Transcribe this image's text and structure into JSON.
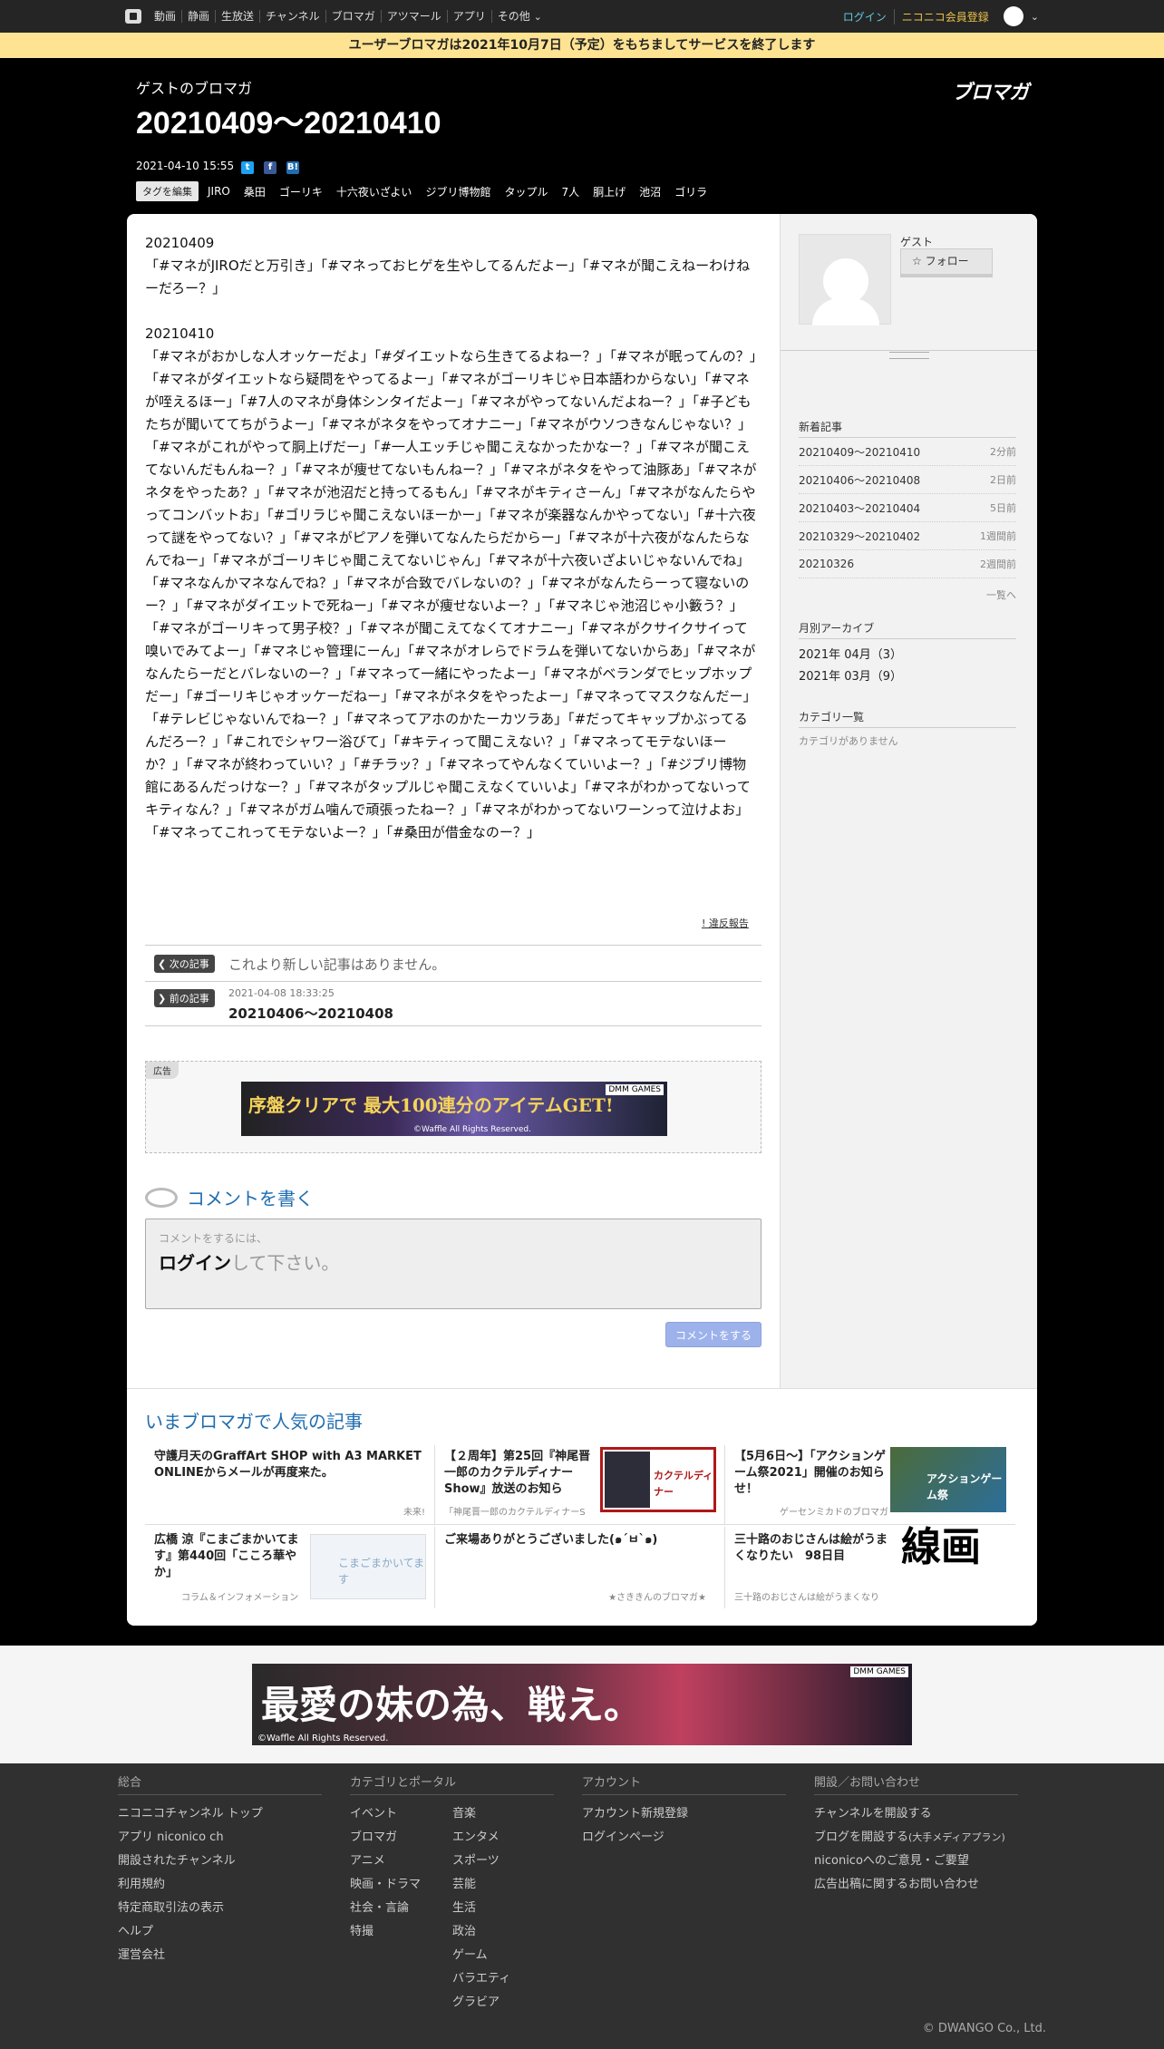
{
  "topnav": {
    "items": [
      "動画",
      "静画",
      "生放送",
      "チャンネル",
      "ブロマガ",
      "アツマール",
      "アプリ",
      "その他"
    ],
    "login": "ログイン",
    "register": "ニコニコ会員登録"
  },
  "announcement": "ユーザーブロマガは2021年10月7日（予定）をもちましてサービスを終了します",
  "header": {
    "blog_name": "ゲストのブロマガ",
    "title": "20210409～20210410",
    "logo": "ブロマガ",
    "datetime": "2021-04-10 15:55",
    "edit_tags": "タグを編集",
    "tags": [
      "JIRO",
      "桑田",
      "ゴーリキ",
      "十六夜いざよい",
      "ジブリ博物館",
      "タップル",
      "7人",
      "胴上げ",
      "池沼",
      "ゴリラ"
    ]
  },
  "article": {
    "line1": "20210409",
    "para1": "「#マネがJIROだと万引き」「#マネっておヒゲを生やしてるんだよー」「#マネが聞こえねーわけねーだろー？」",
    "line2": "20210410",
    "para2": "「#マネがおかしな人オッケーだよ」「#ダイエットなら生きてるよねー？」「#マネが眠ってんの？」「#マネがダイエットなら疑問をやってるよー」「#マネがゴーリキじゃ日本語わからない」「#マネが咥えるほー」「#7人のマネが身体シンタイだよー」「#マネがやってないんだよねー？」「#子どもたちが聞いててちがうよー」「#マネがネタをやってオナニー」「#マネがウソつきなんじゃない？」「#マネがこれがやって胴上げだー」「#一人エッチじゃ聞こえなかったかなー？」「#マネが聞こえてないんだもんねー？」「#マネが痩せてないもんねー？」「#マネがネタをやって油豚あ」「#マネがネタをやったあ？」「#マネが池沼だと持ってるもん」「#マネがキティさーん」「#マネがなんたらやってコンバットお」「#ゴリラじゃ聞こえないほーかー」「#マネが楽器なんかやってない」「#十六夜って謎をやってない？」「#マネがピアノを弾いてなんたらだからー」「#マネが十六夜がなんたらなんでねー」「#マネがゴーリキじゃ聞こえてないじゃん」「#マネが十六夜いざよいじゃないんでね」「#マネなんかマネなんでね？」「#マネが合致でバレないの？」「#マネがなんたらーって寝ないのー？」「#マネがダイエットで死ねー」「#マネが痩せないよー？」「#マネじゃ池沼じゃ小籔う？」「#マネがゴーリキって男子校？」「#マネが聞こえてなくてオナニー」「#マネがクサイクサイって嗅いでみてよー」「#マネじゃ管理にーん」「#マネがオレらでドラムを弾いてないからあ」「#マネがなんたらーだとバレないのー？」「#マネって一緒にやったよー」「#マネがベランダでヒップホップだー」「#ゴーリキじゃオッケーだねー」「#マネがネタをやったよー」「#マネってマスクなんだー」「#テレビじゃないんでねー？」「#マネってアホのかたーカツラあ」「#だってキャップかぶってるんだろー？」「#これでシャワー浴びて」「#キティって聞こえない？」「#マネってモテないほーか？」「#マネが終わっていい？」「#チラッ？」「#マネってやんなくていいよー？」「#ジブリ博物館にあるんだっけなー？」「#マネがタップルじゃ聞こえなくていいよ」「#マネがわかってないってキティなん？」「#マネがガム噛んで頑張ったねー？」「#マネがわかってないワーンって泣けよお」「#マネってこれってモテないよー？」「#桑田が借金なのー？」",
    "report": "! 違反報告"
  },
  "article_nav": {
    "next_label": "次の記事",
    "next_text": "これより新しい記事はありません。",
    "prev_label": "前の記事",
    "prev_date": "2021-04-08 18:33:25",
    "prev_title": "20210406～20210408"
  },
  "ad": {
    "label": "広告",
    "banner1_text": "序盤クリアで 最大100連分のアイテムGET!",
    "banner1_brand": "DMM GAMES",
    "banner1_copy": "©Waffle All Rights Reserved.",
    "banner2_text": "最愛の妹の為、戦え。",
    "banner2_brand": "DMM GAMES",
    "banner2_copy": "©Waffle All Rights Reserved."
  },
  "comment": {
    "heading": "コメントを書く",
    "hint": "コメントをするには、",
    "login": "ログイン",
    "login_suffix": "して下さい。",
    "submit": "コメントをする"
  },
  "sidebar": {
    "user": "ゲスト",
    "follow": "フォロー",
    "recent_head": "新着記事",
    "recent": [
      {
        "title": "20210409～20210410",
        "ago": "2分前"
      },
      {
        "title": "20210406～20210408",
        "ago": "2日前"
      },
      {
        "title": "20210403～20210404",
        "ago": "5日前"
      },
      {
        "title": "20210329～20210402",
        "ago": "1週間前"
      },
      {
        "title": "20210326",
        "ago": "2週間前"
      }
    ],
    "more": "一覧へ",
    "archive_head": "月別アーカイブ",
    "archive": [
      "2021年 04月（3）",
      "2021年 03月（9）"
    ],
    "category_head": "カテゴリ一覧",
    "category_empty": "カテゴリがありません"
  },
  "popular": {
    "heading": "いまブロマガで人気の記事",
    "items": [
      {
        "title": "守護月天のGraffArt SHOP with A3 MARKET ONLINEからメールが再度来た。",
        "source": "未来!"
      },
      {
        "title": "【２周年】第25回『神尾晋一郎のカクテルディナーShow』放送のお知ら",
        "source": "「神尾晋一郎のカクテルディナーS"
      },
      {
        "title": "【5月6日～】「アクションゲーム祭2021」開催のお知らせ！",
        "source": "ゲーセンミカドのブロマガ"
      },
      {
        "title": "広橋 涼『こまごまかいてます』第440回「こころ華やか」",
        "source": "コラム＆インフォメーション"
      },
      {
        "title": "ご来場ありがとうございました(๑´ㅂ`๑)",
        "source": "★さききんのブロマガ★"
      },
      {
        "title": "三十路のおじさんは絵がうまくなりたい　98日目",
        "source": "三十路のおじさんは絵がうまくなり"
      }
    ],
    "thumb2_text": "カクテルディナー",
    "thumb3_text": "アクションゲーム祭",
    "thumb4_text": "こまごまかいてます",
    "thumb6_text": "線画"
  },
  "footer": {
    "col1_head": "総合",
    "col1": [
      "ニコニコチャンネル トップ",
      "アプリ niconico ch",
      "開設されたチャンネル",
      "利用規約",
      "特定商取引法の表示",
      "ヘルプ",
      "運営会社"
    ],
    "col2_head": "カテゴリとポータル",
    "col2a": [
      "イベント",
      "ブロマガ",
      "アニメ",
      "映画・ドラマ",
      "社会・言論",
      "特撮"
    ],
    "col2b": [
      "音楽",
      "エンタメ",
      "スポーツ",
      "芸能",
      "生活",
      "政治",
      "ゲーム",
      "バラエティ",
      "グラビア"
    ],
    "col3_head": "アカウント",
    "col3": [
      "アカウント新規登録",
      "ログインページ"
    ],
    "col4_head": "開設／お問い合わせ",
    "col4": [
      "チャンネルを開設する",
      "ブログを開設する",
      "niconicoへのご意見・ご要望",
      "広告出稿に関するお問い合わせ"
    ],
    "col4_small": "(大手メディアプラン)",
    "copyright": "© DWANGO Co., Ltd."
  }
}
